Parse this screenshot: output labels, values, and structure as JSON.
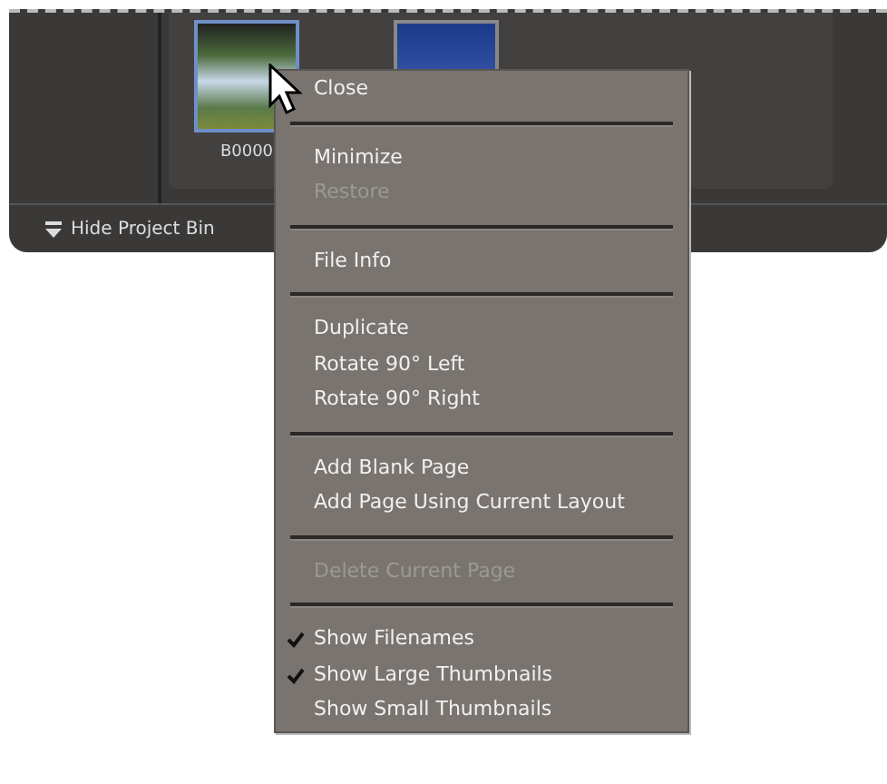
{
  "project_bin": {
    "thumbnails": [
      {
        "caption": "B0000",
        "selected": true
      },
      {
        "selected": false
      }
    ],
    "toggle_label": "Hide Project Bin"
  },
  "context_menu": {
    "groups": [
      {
        "items": [
          {
            "label": "Close",
            "disabled": false
          }
        ]
      },
      {
        "items": [
          {
            "label": "Minimize",
            "disabled": false
          },
          {
            "label": "Restore",
            "disabled": true
          }
        ]
      },
      {
        "items": [
          {
            "label": "File Info",
            "disabled": false
          }
        ]
      },
      {
        "items": [
          {
            "label": "Duplicate",
            "disabled": false
          },
          {
            "label": "Rotate 90° Left",
            "disabled": false
          },
          {
            "label": "Rotate 90° Right",
            "disabled": false
          }
        ]
      },
      {
        "items": [
          {
            "label": "Add Blank Page",
            "disabled": false
          },
          {
            "label": "Add Page Using Current Layout",
            "disabled": false
          }
        ]
      },
      {
        "items": [
          {
            "label": "Delete Current Page",
            "disabled": true
          }
        ]
      },
      {
        "items": [
          {
            "label": "Show Filenames",
            "disabled": false,
            "checked": true
          },
          {
            "label": "Show Large Thumbnails",
            "disabled": false,
            "checked": true
          },
          {
            "label": "Show Small Thumbnails",
            "disabled": false,
            "checked": false
          }
        ]
      }
    ]
  }
}
